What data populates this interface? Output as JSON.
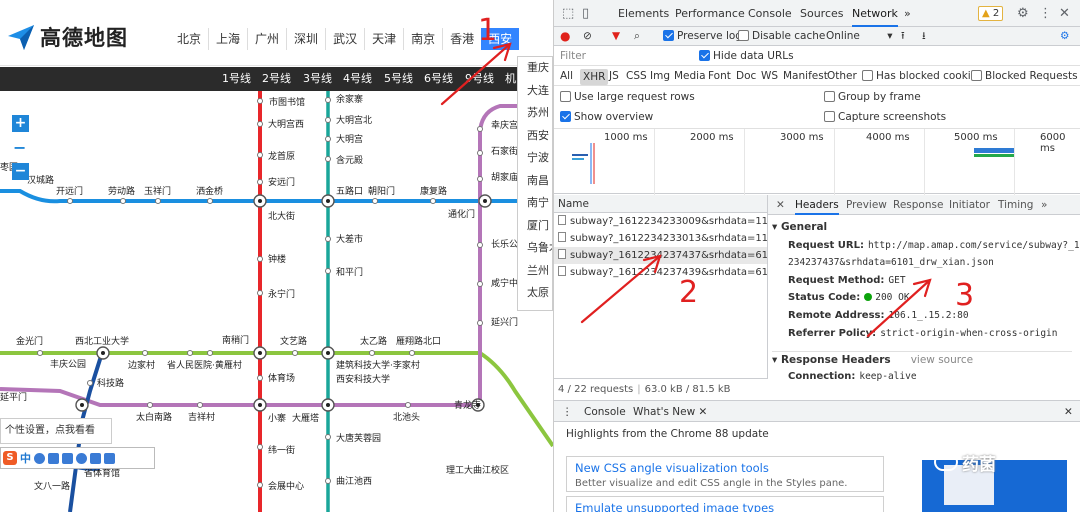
{
  "map": {
    "logo_text": "高德地图",
    "city_tabs": [
      "北京",
      "上海",
      "广州",
      "深圳",
      "武汉",
      "天津",
      "南京",
      "香港",
      "西安"
    ],
    "city_dropdown": [
      "重庆",
      "大连",
      "苏州",
      "西安",
      "宁波",
      "南昌",
      "南宁",
      "厦门",
      "乌鲁木",
      "兰州",
      "太原"
    ],
    "line_bar": [
      "1号线",
      "2号线",
      "3号线",
      "4号线",
      "5号线",
      "6号线",
      "9号线",
      "机"
    ],
    "zoom_in": "+",
    "zoom_out": "−",
    "tip_text": "个性设置，点我看看",
    "ime_zh": "中",
    "ime_s": "S",
    "stations": {
      "s_tushuguan": "市图书馆",
      "s_damingongxi": "大明宫西",
      "s_longshouyuan": "龙首原",
      "s_anyuanmen": "安远门",
      "s_beidajie": "北大街",
      "s_zhonglou": "钟楼",
      "s_yongningmen": "永宁门",
      "s_nanshaomen": "南稍门",
      "s_tiyuchang": "体育场",
      "s_xiaozhai": "小寨",
      "s_dayanta": "大雁塔",
      "s_weiyijie": "纬一街",
      "s_huizhanzhongxin": "会展中心",
      "s_yujiazhai": "余家寨",
      "s_damingongbei": "大明宫北",
      "s_damingong": "大明宫",
      "s_hanyuandian": "含元殿",
      "s_wuluko": "五路口",
      "s_chaoyangmen": "朝阳门",
      "s_kangfulu": "康复路",
      "s_tonghuamen": "通化门",
      "s_dachashi": "大差市",
      "s_hepingmen": "和平门",
      "s_jianzhukeji": "建筑科技大学·李家村",
      "s_xianKeji": "西安科技大学",
      "s_beichitou": "北池头",
      "s_datangfurongyuan": "大唐芙蓉园",
      "s_qujiangchixi": "曲江池西",
      "s_taiyilu": "太乙路",
      "s_yanxiangbeikou": "雁翔路北口",
      "s_wenyilu": "文艺路",
      "s_qinglongsi": "青龙寺",
      "s_ligongdaqujiang": "理工大曲江校区",
      "s_hanchenglu": "汉城路",
      "s_kaiyuanmen": "开远门",
      "s_laodonglu": "劳动路",
      "s_yuxiangmen": "玉祥门",
      "s_sajinqiao": "洒金桥",
      "s_xibeigongye": "西北工业大学",
      "s_jinguangmen": "金光门",
      "s_fengqinggongyuan": "丰庆公园",
      "s_bianjiacun": "边家村",
      "s_shengrenminyiyuan": "省人民医院·黄雁村",
      "s_kejilu": "科技路",
      "s_yanpingmen": "延平门",
      "s_taibainanlu": "太白南路",
      "s_jixiangcun": "吉祥村",
      "s_shengtiyuguan": "省体育馆",
      "s_wenbayilu": "文八一路",
      "s_xingqinggong": "幸庆宫",
      "s_shijiamen": "石家街",
      "s_huchengmen": "胡家庙",
      "s_changlegongyuan": "长乐公",
      "s_xianningmen": "咸宁中路",
      "s_yanxingmen": "延兴门",
      "s_zaoci": "枣园"
    }
  },
  "devtools": {
    "tabs": [
      "Elements",
      "Performance",
      "Console",
      "Sources",
      "Network"
    ],
    "more_tabs": "»",
    "warn_count": "2",
    "toolbar": {
      "preserve_log": "Preserve log",
      "disable_cache": "Disable cache",
      "throttle": "Online"
    },
    "filter_placeholder": "Filter",
    "hide_data_urls": "Hide data URLs",
    "types": [
      "All",
      "XHR",
      "JS",
      "CSS",
      "Img",
      "Media",
      "Font",
      "Doc",
      "WS",
      "Manifest",
      "Other"
    ],
    "has_blocked_cookies": "Has blocked cookies",
    "blocked_requests": "Blocked Requests",
    "opt_large_rows": "Use large request rows",
    "opt_group_frame": "Group by frame",
    "opt_show_overview": "Show overview",
    "opt_capture": "Capture screenshots",
    "overview_ticks": [
      "1000 ms",
      "2000 ms",
      "3000 ms",
      "4000 ms",
      "5000 ms",
      "6000 ms"
    ],
    "name_header": "Name",
    "requests": [
      "subway?_1612234233009&srhdata=1100_d...",
      "subway?_1612234233013&srhdata=1100_i...",
      "subway?_1612234237437&srhdata=6101_d...",
      "subway?_1612234237439&srhdata=6101_i..."
    ],
    "status_requests": "4 / 22 requests",
    "status_transferred": "63.0 kB / 81.5 kB transferred",
    "detail_tabs": [
      "Headers",
      "Preview",
      "Response",
      "Initiator",
      "Timing"
    ],
    "general_label": "General",
    "request_url_key": "Request URL:",
    "request_url_val1": "http://map.amap.com/service/subway?_1612",
    "request_url_val2": "234237437&srhdata=6101_drw_xian.json",
    "request_method_key": "Request Method:",
    "request_method_val": "GET",
    "status_code_key": "Status Code:",
    "status_code_val": "200 OK",
    "remote_addr_key": "Remote Address:",
    "remote_addr_val": "106.1_.15.2:80",
    "referrer_key": "Referrer Policy:",
    "referrer_val": "strict-origin-when-cross-origin",
    "response_headers_label": "Response Headers",
    "view_source": "view source",
    "connection_key": "Connection:",
    "connection_val": "keep-alive",
    "drawer_console": "Console",
    "drawer_whatsnew": "What's New",
    "highlights": "Highlights from the Chrome 88 update",
    "card1_title": "New CSS angle visualization tools",
    "card1_sub": "Better visualize and edit CSS angle in the Styles pane.",
    "card2_title": "Emulate unsupported image types"
  },
  "annotations": [
    "1",
    "2",
    "3"
  ],
  "watermark": "药菌"
}
